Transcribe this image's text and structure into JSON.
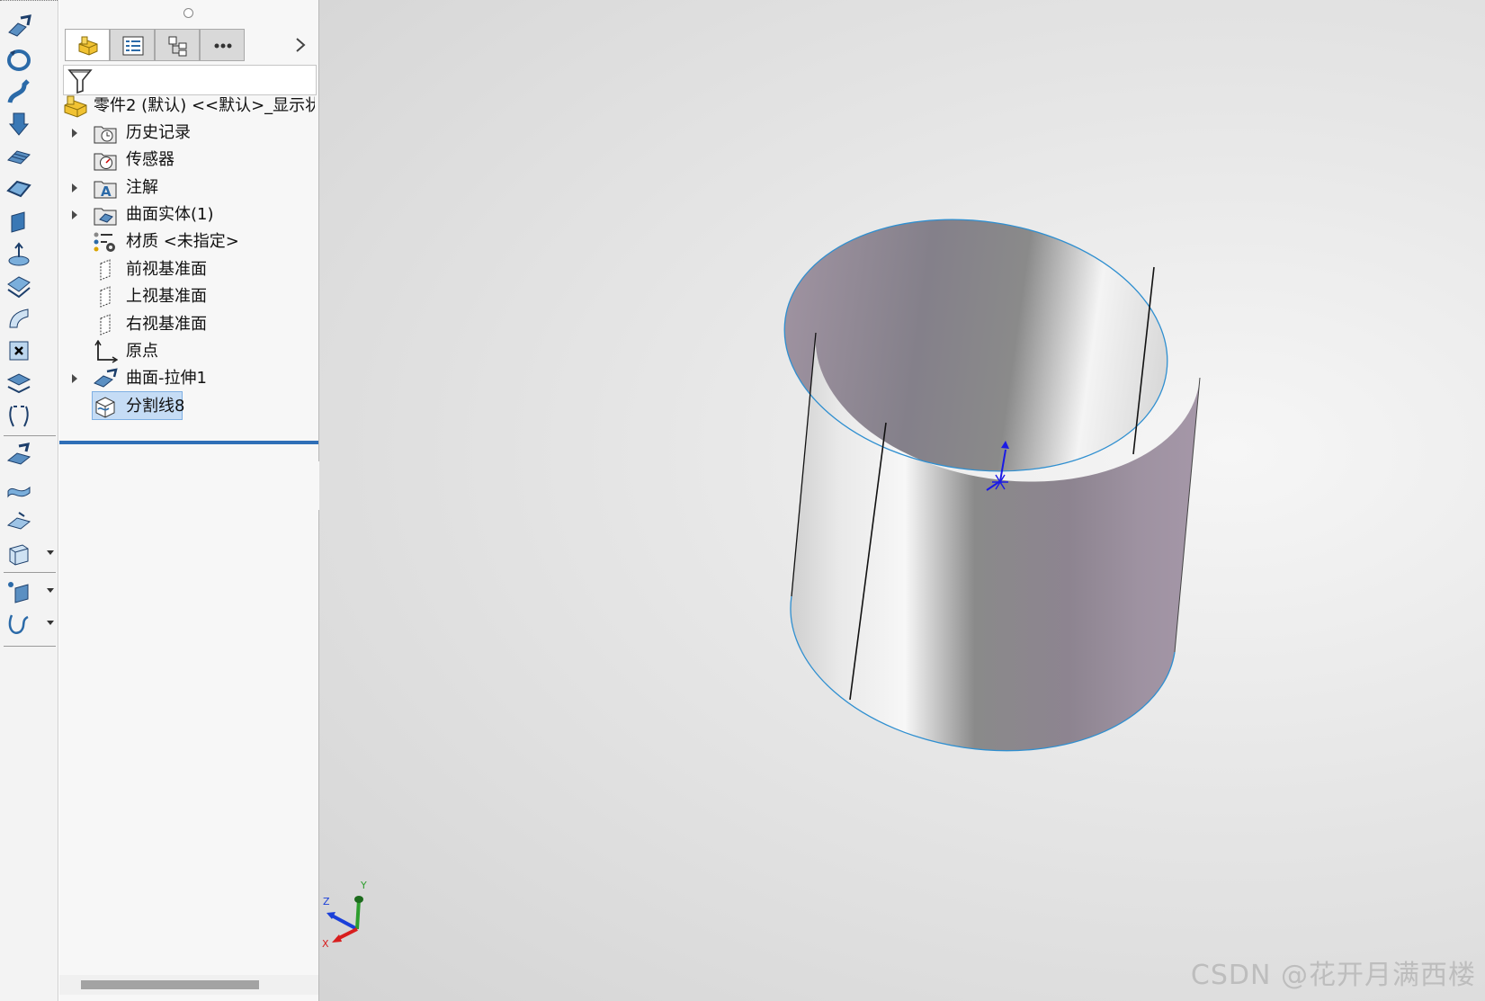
{
  "feature_tree": {
    "root_label": "零件2 (默认) <<默认>_显示状态",
    "nodes": [
      {
        "label": "历史记录",
        "icon": "history-folder-icon",
        "expandable": true
      },
      {
        "label": "传感器",
        "icon": "sensor-icon",
        "expandable": false
      },
      {
        "label": "注解",
        "icon": "annotation-icon",
        "expandable": true
      },
      {
        "label": "曲面实体(1)",
        "icon": "surface-bodies-folder-icon",
        "expandable": true
      },
      {
        "label": "材质 <未指定>",
        "icon": "material-icon",
        "expandable": false
      },
      {
        "label": "前视基准面",
        "icon": "plane-icon",
        "expandable": false
      },
      {
        "label": "上视基准面",
        "icon": "plane-icon",
        "expandable": false
      },
      {
        "label": "右视基准面",
        "icon": "plane-icon",
        "expandable": false
      },
      {
        "label": "原点",
        "icon": "origin-icon",
        "expandable": false
      },
      {
        "label": "曲面-拉伸1",
        "icon": "surface-extrude-icon",
        "expandable": true
      },
      {
        "label": "分割线8",
        "icon": "split-line-icon",
        "expandable": false,
        "selected": true
      }
    ]
  },
  "panel_tabs": [
    {
      "name": "featuremanager-tab",
      "icon": "part-icon",
      "active": true
    },
    {
      "name": "propertymanager-tab",
      "icon": "property-list-icon",
      "active": false
    },
    {
      "name": "configurationmanager-tab",
      "icon": "configuration-icon",
      "active": false
    },
    {
      "name": "more-tab",
      "icon": "more-dots-icon",
      "active": false
    }
  ],
  "toolbar_tools": [
    "extruded-surface-icon",
    "revolved-surface-icon",
    "swept-surface-icon",
    "lofted-surface-icon",
    "boundary-surface-icon",
    "filled-surface-icon",
    "planar-surface-icon",
    "offset-surface-icon",
    "ruled-surface-icon",
    "surface-flatten-icon",
    "delete-face-icon",
    "replace-face-icon",
    "untrim-surface-icon",
    "extend-surface-icon",
    "trim-surface-icon",
    "knit-surface-icon",
    "thicken-icon",
    "reference-geometry-icon",
    "curves-icon"
  ],
  "triad": {
    "x_label": "X",
    "y_label": "Y",
    "z_label": "Z"
  },
  "watermark": "CSDN @花开月满西楼",
  "colors": {
    "selection": "#c5dcf5",
    "rollback_bar": "#2f6fb7",
    "edge_highlight": "#2f8fd0",
    "surface_tint": "#9a8f9e"
  }
}
